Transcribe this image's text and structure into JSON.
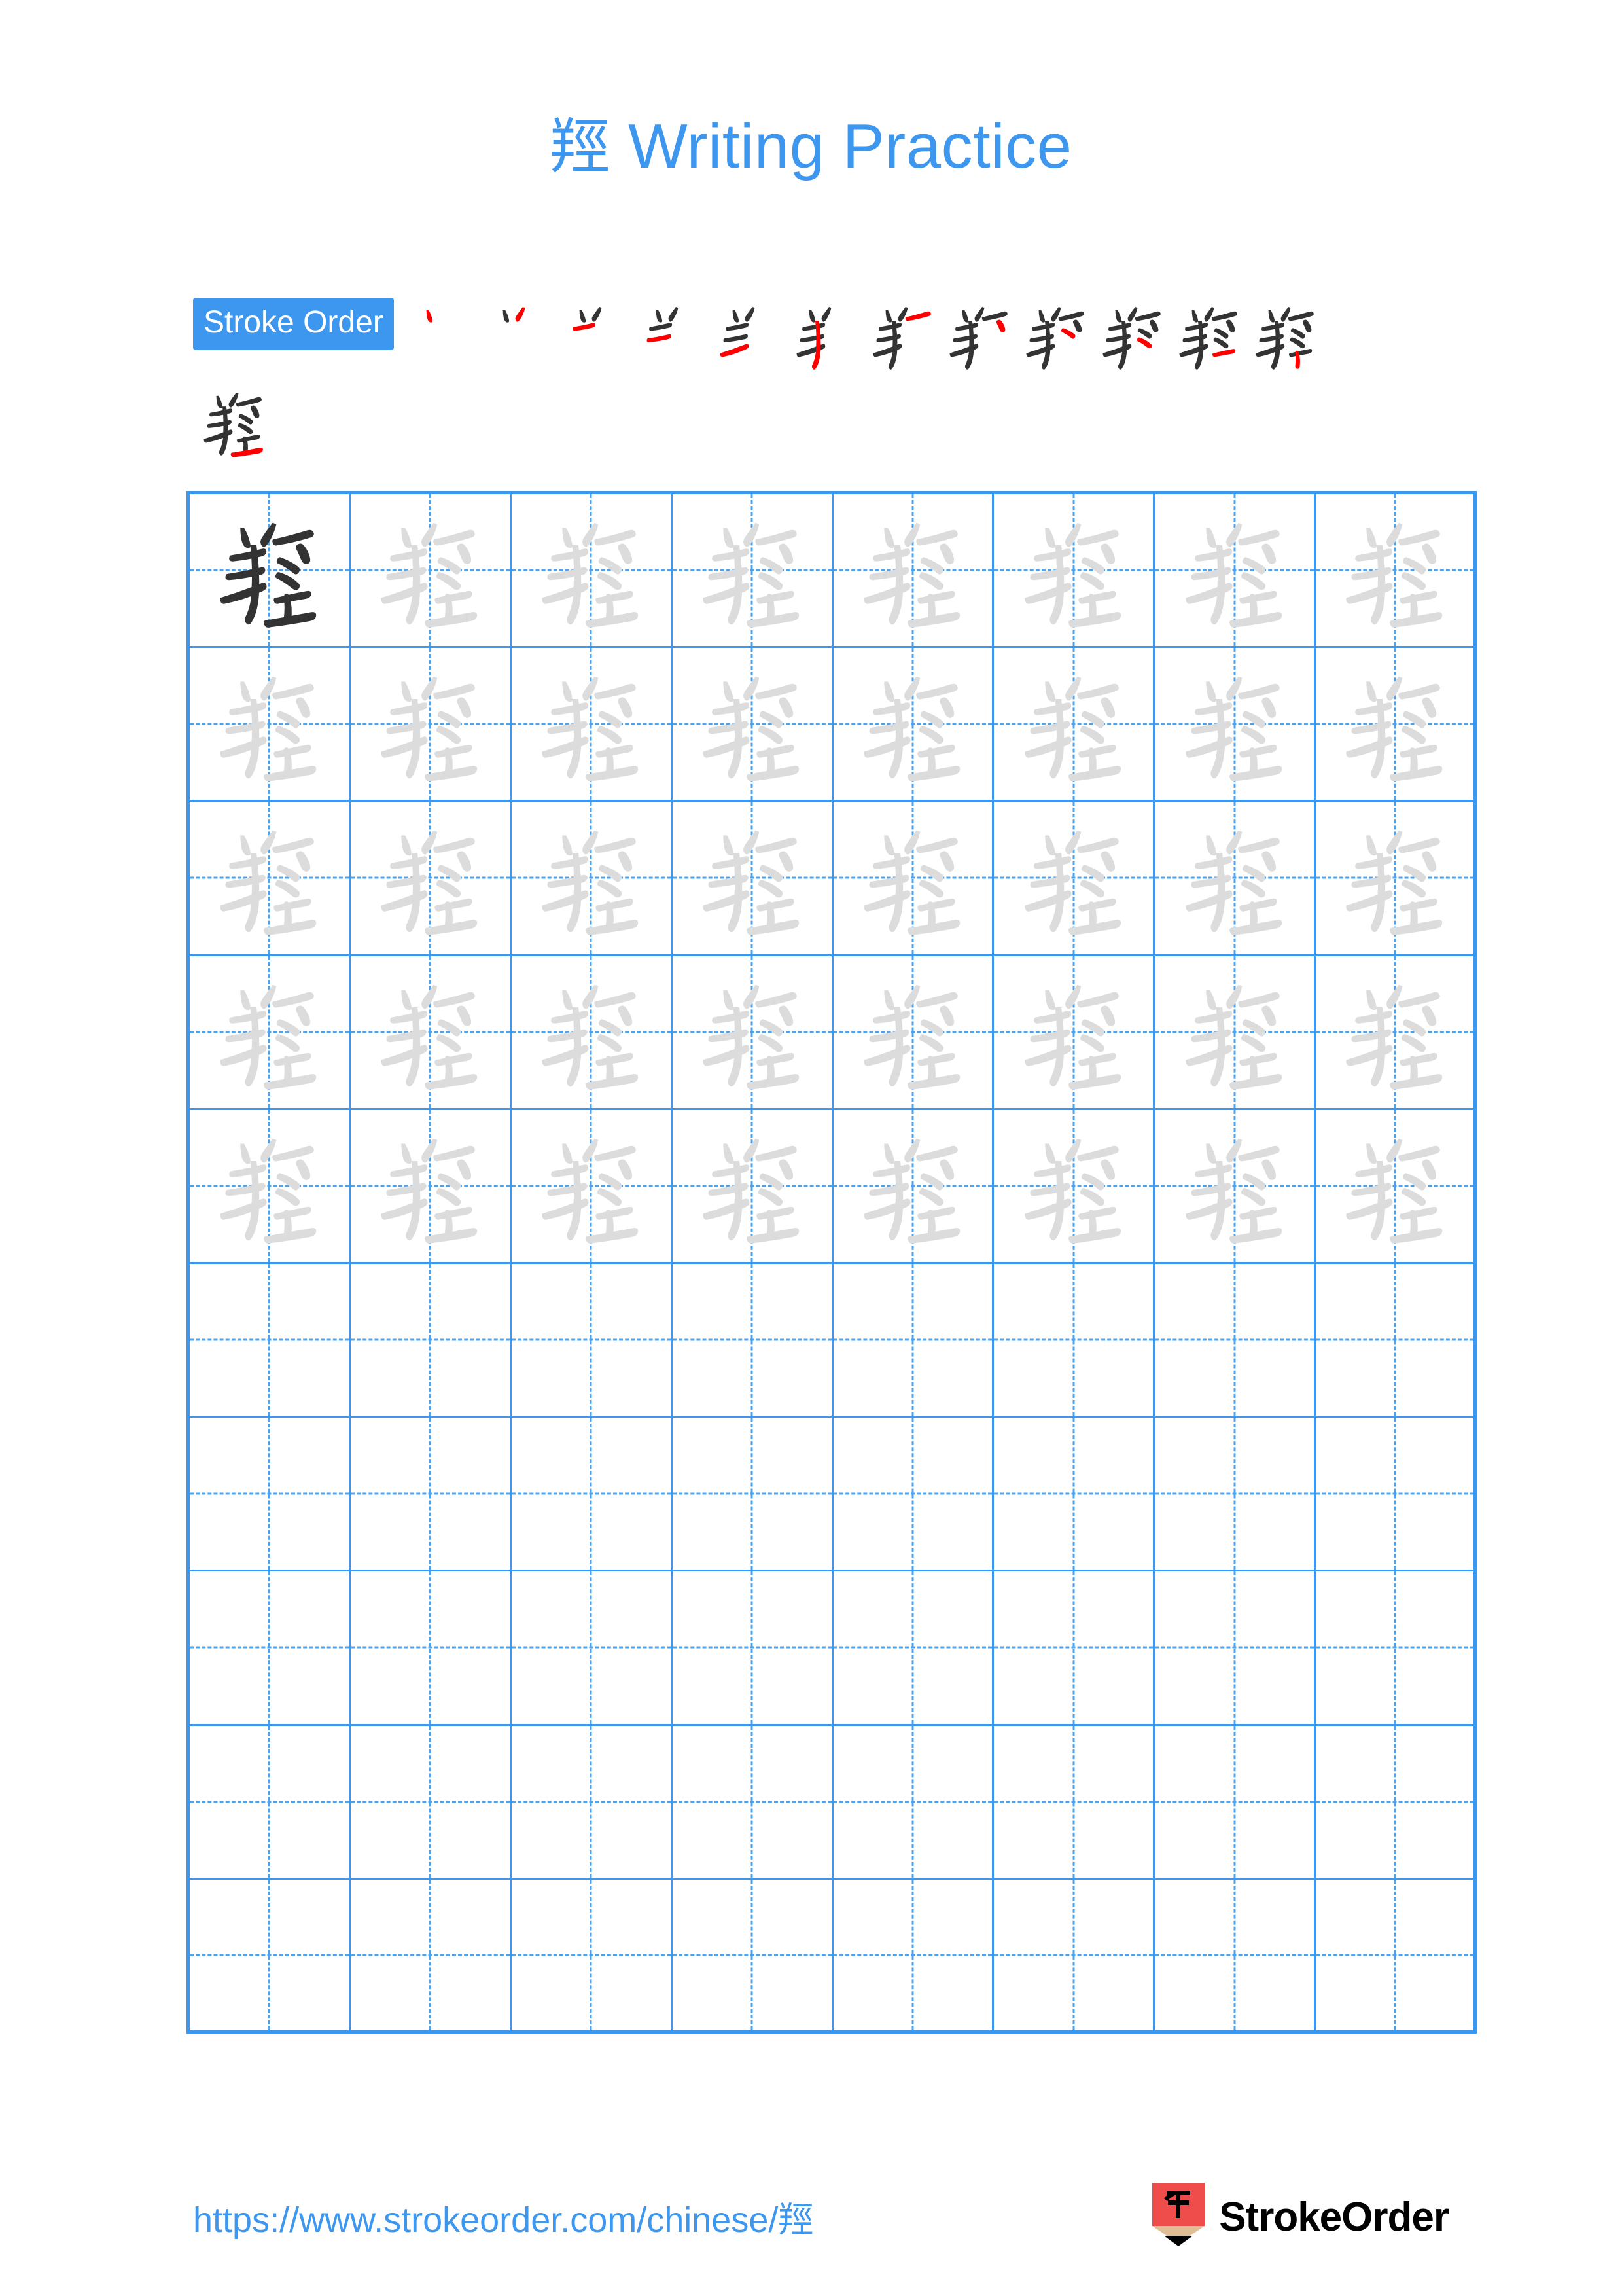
{
  "document": {
    "character": "羥",
    "title_suffix": "Writing Practice",
    "title_full": "羥 Writing Practice"
  },
  "colors": {
    "accent_blue": "#3d97ef",
    "grid_line": "#3d97ef",
    "guide_dash": "#4aa3f0",
    "stroke_new": "#ff0000",
    "stroke_done": "#333333",
    "trace_gray": "#dcdcdc",
    "logo_red": "#ef4c4c",
    "logo_wood": "#e0bd95"
  },
  "stroke_order": {
    "label": "Stroke Order",
    "total_strokes": 13,
    "steps": [
      1,
      2,
      3,
      4,
      5,
      6,
      7,
      8,
      9,
      10,
      11,
      12,
      13
    ],
    "row1_count": 12,
    "row2_count": 1
  },
  "practice_grid": {
    "columns": 8,
    "rows": 10,
    "filled_rows": 5,
    "empty_rows": 5,
    "first_cell_style": "dark",
    "trace_cell_style": "light",
    "total_cells": 80
  },
  "footer": {
    "url_text": "https://www.strokeorder.com/chinese/羥",
    "brand_name": "StrokeOrder",
    "brand_icon_char": "字",
    "brand_icon_name": "pencil-logo-icon"
  }
}
